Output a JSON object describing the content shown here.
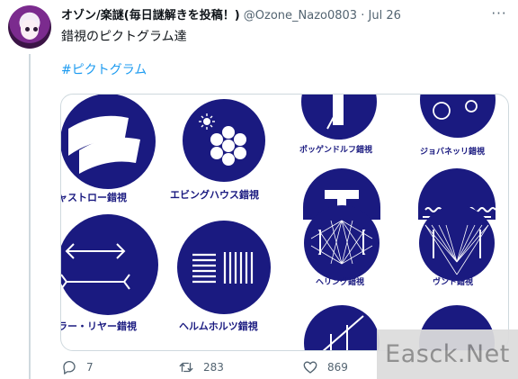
{
  "tweet": {
    "author_name": "オゾン/楽謎(毎日謎解きを投稿！)",
    "handle": "@Ozone_Nazo0803",
    "separator": "·",
    "date": "Jul 26",
    "more_label": "···",
    "text": "錯視のピクトグラム達",
    "hashtag": "#ピクトグラム"
  },
  "media": {
    "pictograms": [
      {
        "caption": "ャストロー錯視"
      },
      {
        "caption": "エビングハウス錯視"
      },
      {
        "caption": "ポッゲンドルフ錯視"
      },
      {
        "caption": "ジョバネッリ錯視"
      },
      {
        "caption": "ラー・リヤー錯視"
      },
      {
        "caption": "ヘルムホルツ錯視"
      },
      {
        "caption": "ヘリング錯視"
      },
      {
        "caption": "ヴント錯視"
      }
    ],
    "colors": {
      "pictogram": "#1a1a80",
      "background": "#ffffff"
    }
  },
  "actions": {
    "reply_count": "7",
    "retweet_count": "283",
    "like_count": "869"
  },
  "watermark": {
    "text": "Easck.Net"
  }
}
